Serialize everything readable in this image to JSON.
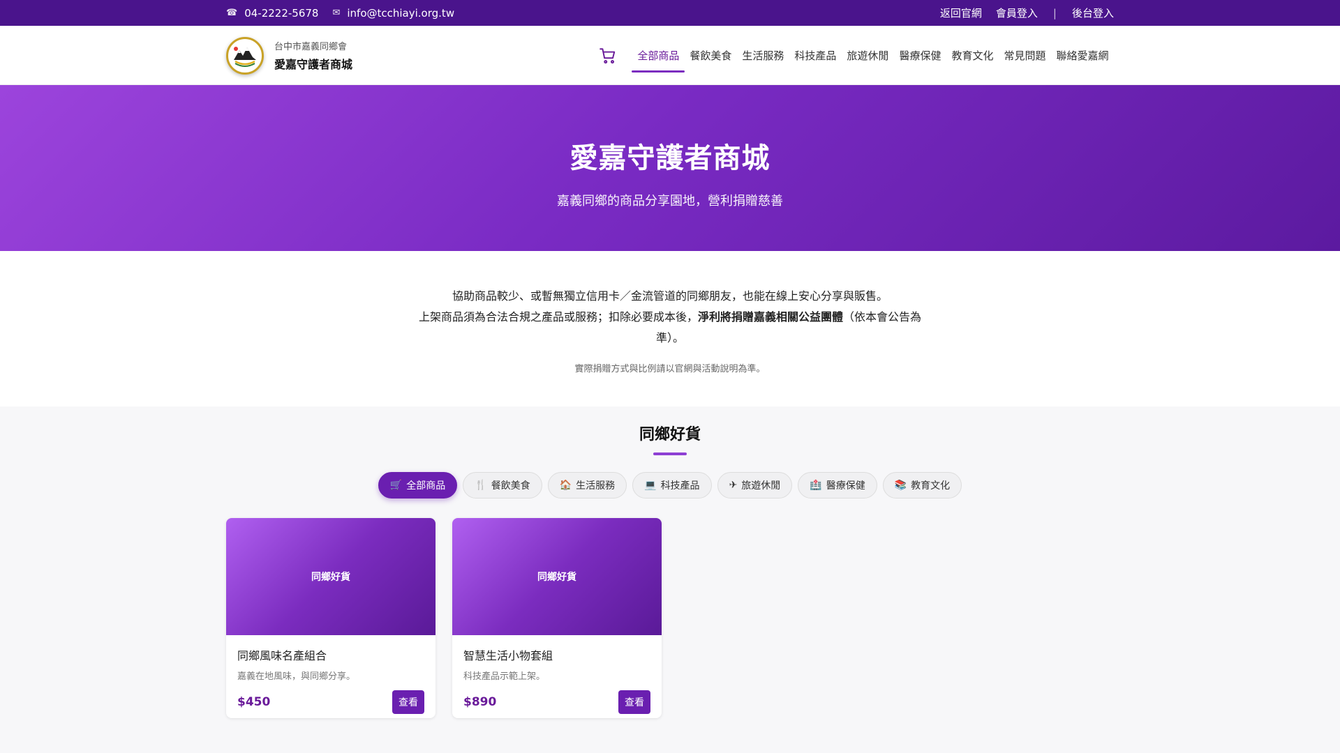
{
  "topbar": {
    "phone": "04-2222-5678",
    "email": "info@tcchiayi.org.tw",
    "links": [
      "返回官網",
      "會員登入",
      "|",
      "後台登入"
    ]
  },
  "brand": {
    "sub": "台中市嘉義同鄉會",
    "main": "愛嘉守護者商城"
  },
  "nav": [
    "全部商品",
    "餐飲美食",
    "生活服務",
    "科技產品",
    "旅遊休閒",
    "醫療保健",
    "教育文化",
    "常見問題",
    "聯絡愛嘉網"
  ],
  "hero": {
    "title": "愛嘉守護者商城",
    "subtitle": "嘉義同鄉的商品分享園地，營利捐贈慈善"
  },
  "intro": {
    "line1": "協助商品較少、或暫無獨立信用卡／金流管道的同鄉朋友，也能在線上安心分享與販售。",
    "line2_pre": "上架商品須為合法合規之產品或服務；扣除必要成本後，",
    "line2_bold": "淨利將捐贈嘉義相關公益團體",
    "line2_post": "（依本會公告為準）。",
    "note": "實際捐贈方式與比例請以官網與活動說明為準。"
  },
  "products": {
    "title": "同鄉好貨",
    "filters": [
      {
        "icon": "🛒",
        "label": "全部商品"
      },
      {
        "icon": "🍴",
        "label": "餐飲美食"
      },
      {
        "icon": "🏠",
        "label": "生活服務"
      },
      {
        "icon": "💻",
        "label": "科技產品"
      },
      {
        "icon": "✈",
        "label": "旅遊休閒"
      },
      {
        "icon": "🏥",
        "label": "醫療保健"
      },
      {
        "icon": "📚",
        "label": "教育文化"
      }
    ],
    "items": [
      {
        "image_label": "同鄉好貨",
        "name": "同鄉風味名產組合",
        "desc": "嘉義在地風味，與同鄉分享。",
        "price": "$450",
        "button": "查看"
      },
      {
        "image_label": "同鄉好貨",
        "name": "智慧生活小物套組",
        "desc": "科技產品示範上架。",
        "price": "$890",
        "button": "查看"
      }
    ]
  },
  "colors": {
    "primary": "#6a1fb0",
    "topbar": "#4a148c"
  }
}
